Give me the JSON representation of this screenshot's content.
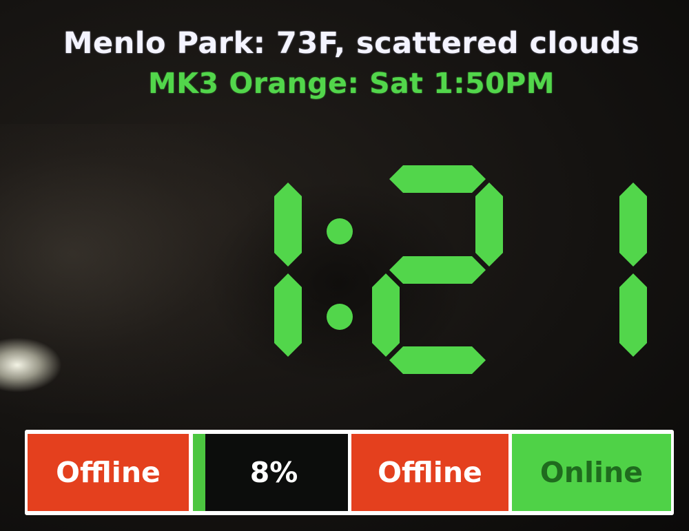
{
  "header": {
    "weather_line": "Menlo Park: 73F, scattered clouds",
    "train_line": "MK3 Orange: Sat 1:50PM"
  },
  "clock": {
    "time": "1:21",
    "digits": [
      "1",
      "2",
      "1"
    ],
    "color": "#52d64b"
  },
  "status_bar": {
    "cells": [
      {
        "label": "Offline",
        "color": "#e4401e"
      },
      {
        "label": "8%",
        "progress_percent": 8,
        "fill_color": "#4cc640"
      },
      {
        "label": "Offline",
        "color": "#e4401e"
      },
      {
        "label": "Online",
        "color": "#4fd247"
      }
    ]
  }
}
